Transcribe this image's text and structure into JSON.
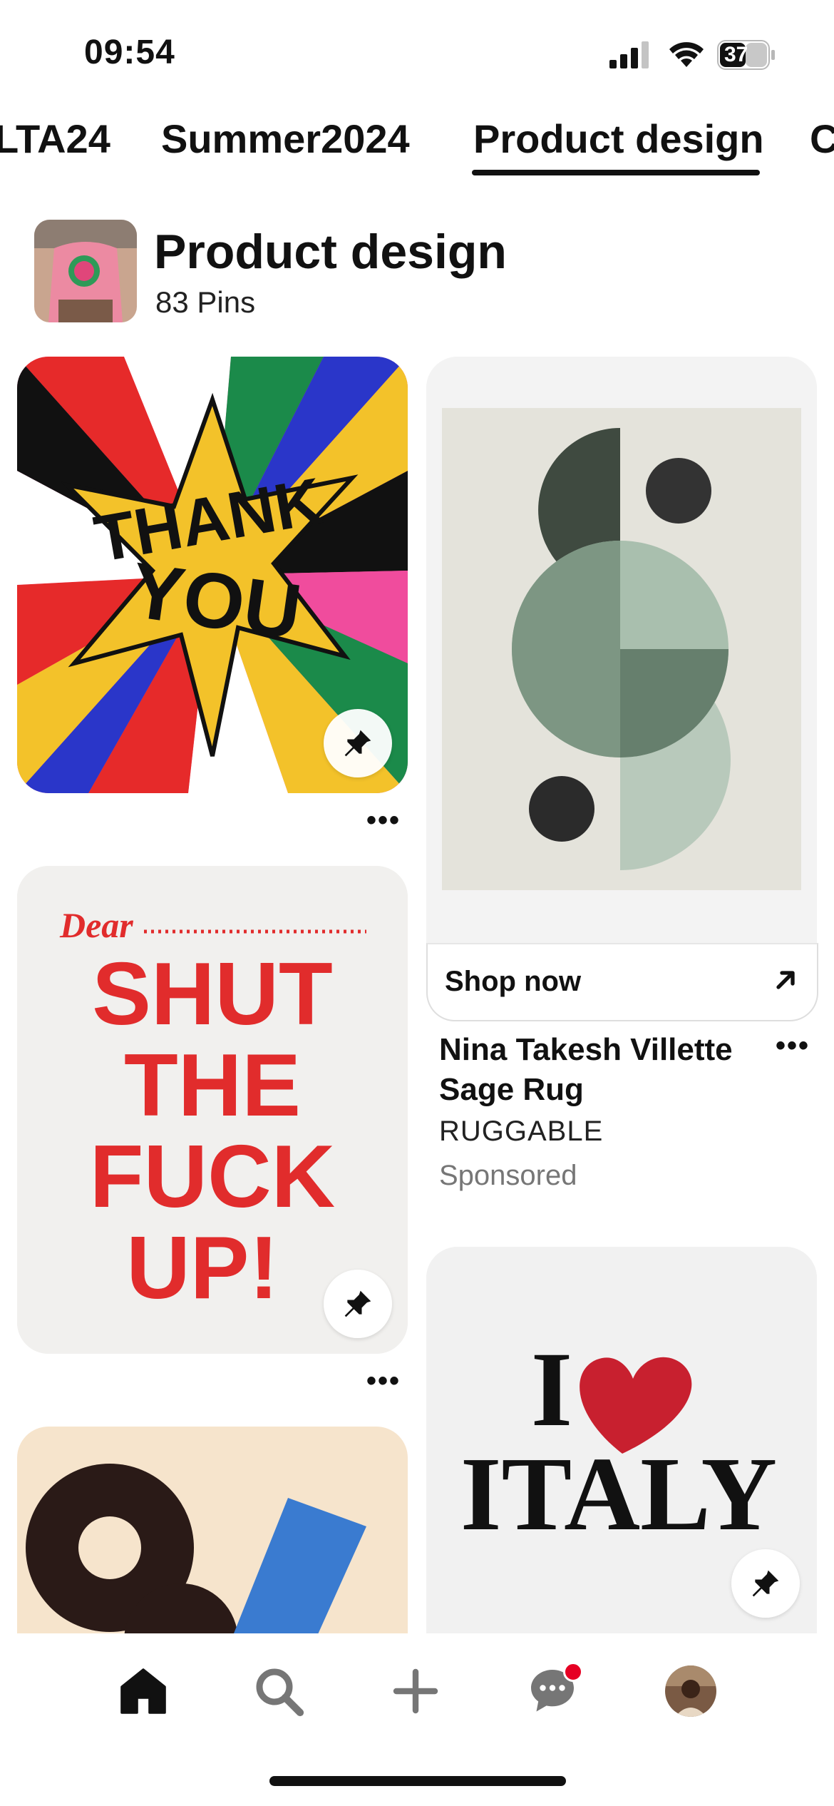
{
  "status_bar": {
    "time": "09:54",
    "battery": "37"
  },
  "tabs": [
    {
      "label": "LTA24"
    },
    {
      "label": "Summer2024"
    },
    {
      "label": "Product design",
      "selected": true
    },
    {
      "label": "C"
    }
  ],
  "board": {
    "title": "Product design",
    "pin_count": "83 Pins"
  },
  "pins": {
    "thank_you": {
      "text_top": "THANK",
      "text_bottom": "YOU"
    },
    "shut_up": {
      "dear": "Dear",
      "lines": [
        "SHUT",
        "THE",
        "FUCK",
        "UP!"
      ]
    },
    "rug_ad": {
      "cta": "Shop now",
      "title": "Nina Takesh Villette Sage Rug",
      "brand": "RUGGABLE",
      "sponsored": "Sponsored"
    },
    "italy": {
      "line1": "I",
      "line2": "ITALY"
    }
  },
  "more_label": "•••",
  "colors": {
    "brand_red": "#e60023",
    "text": "#111111",
    "muted": "#767676"
  },
  "bottom_nav": {
    "items": [
      "home-icon",
      "search-icon",
      "create-icon",
      "messages-icon",
      "profile-avatar"
    ]
  }
}
